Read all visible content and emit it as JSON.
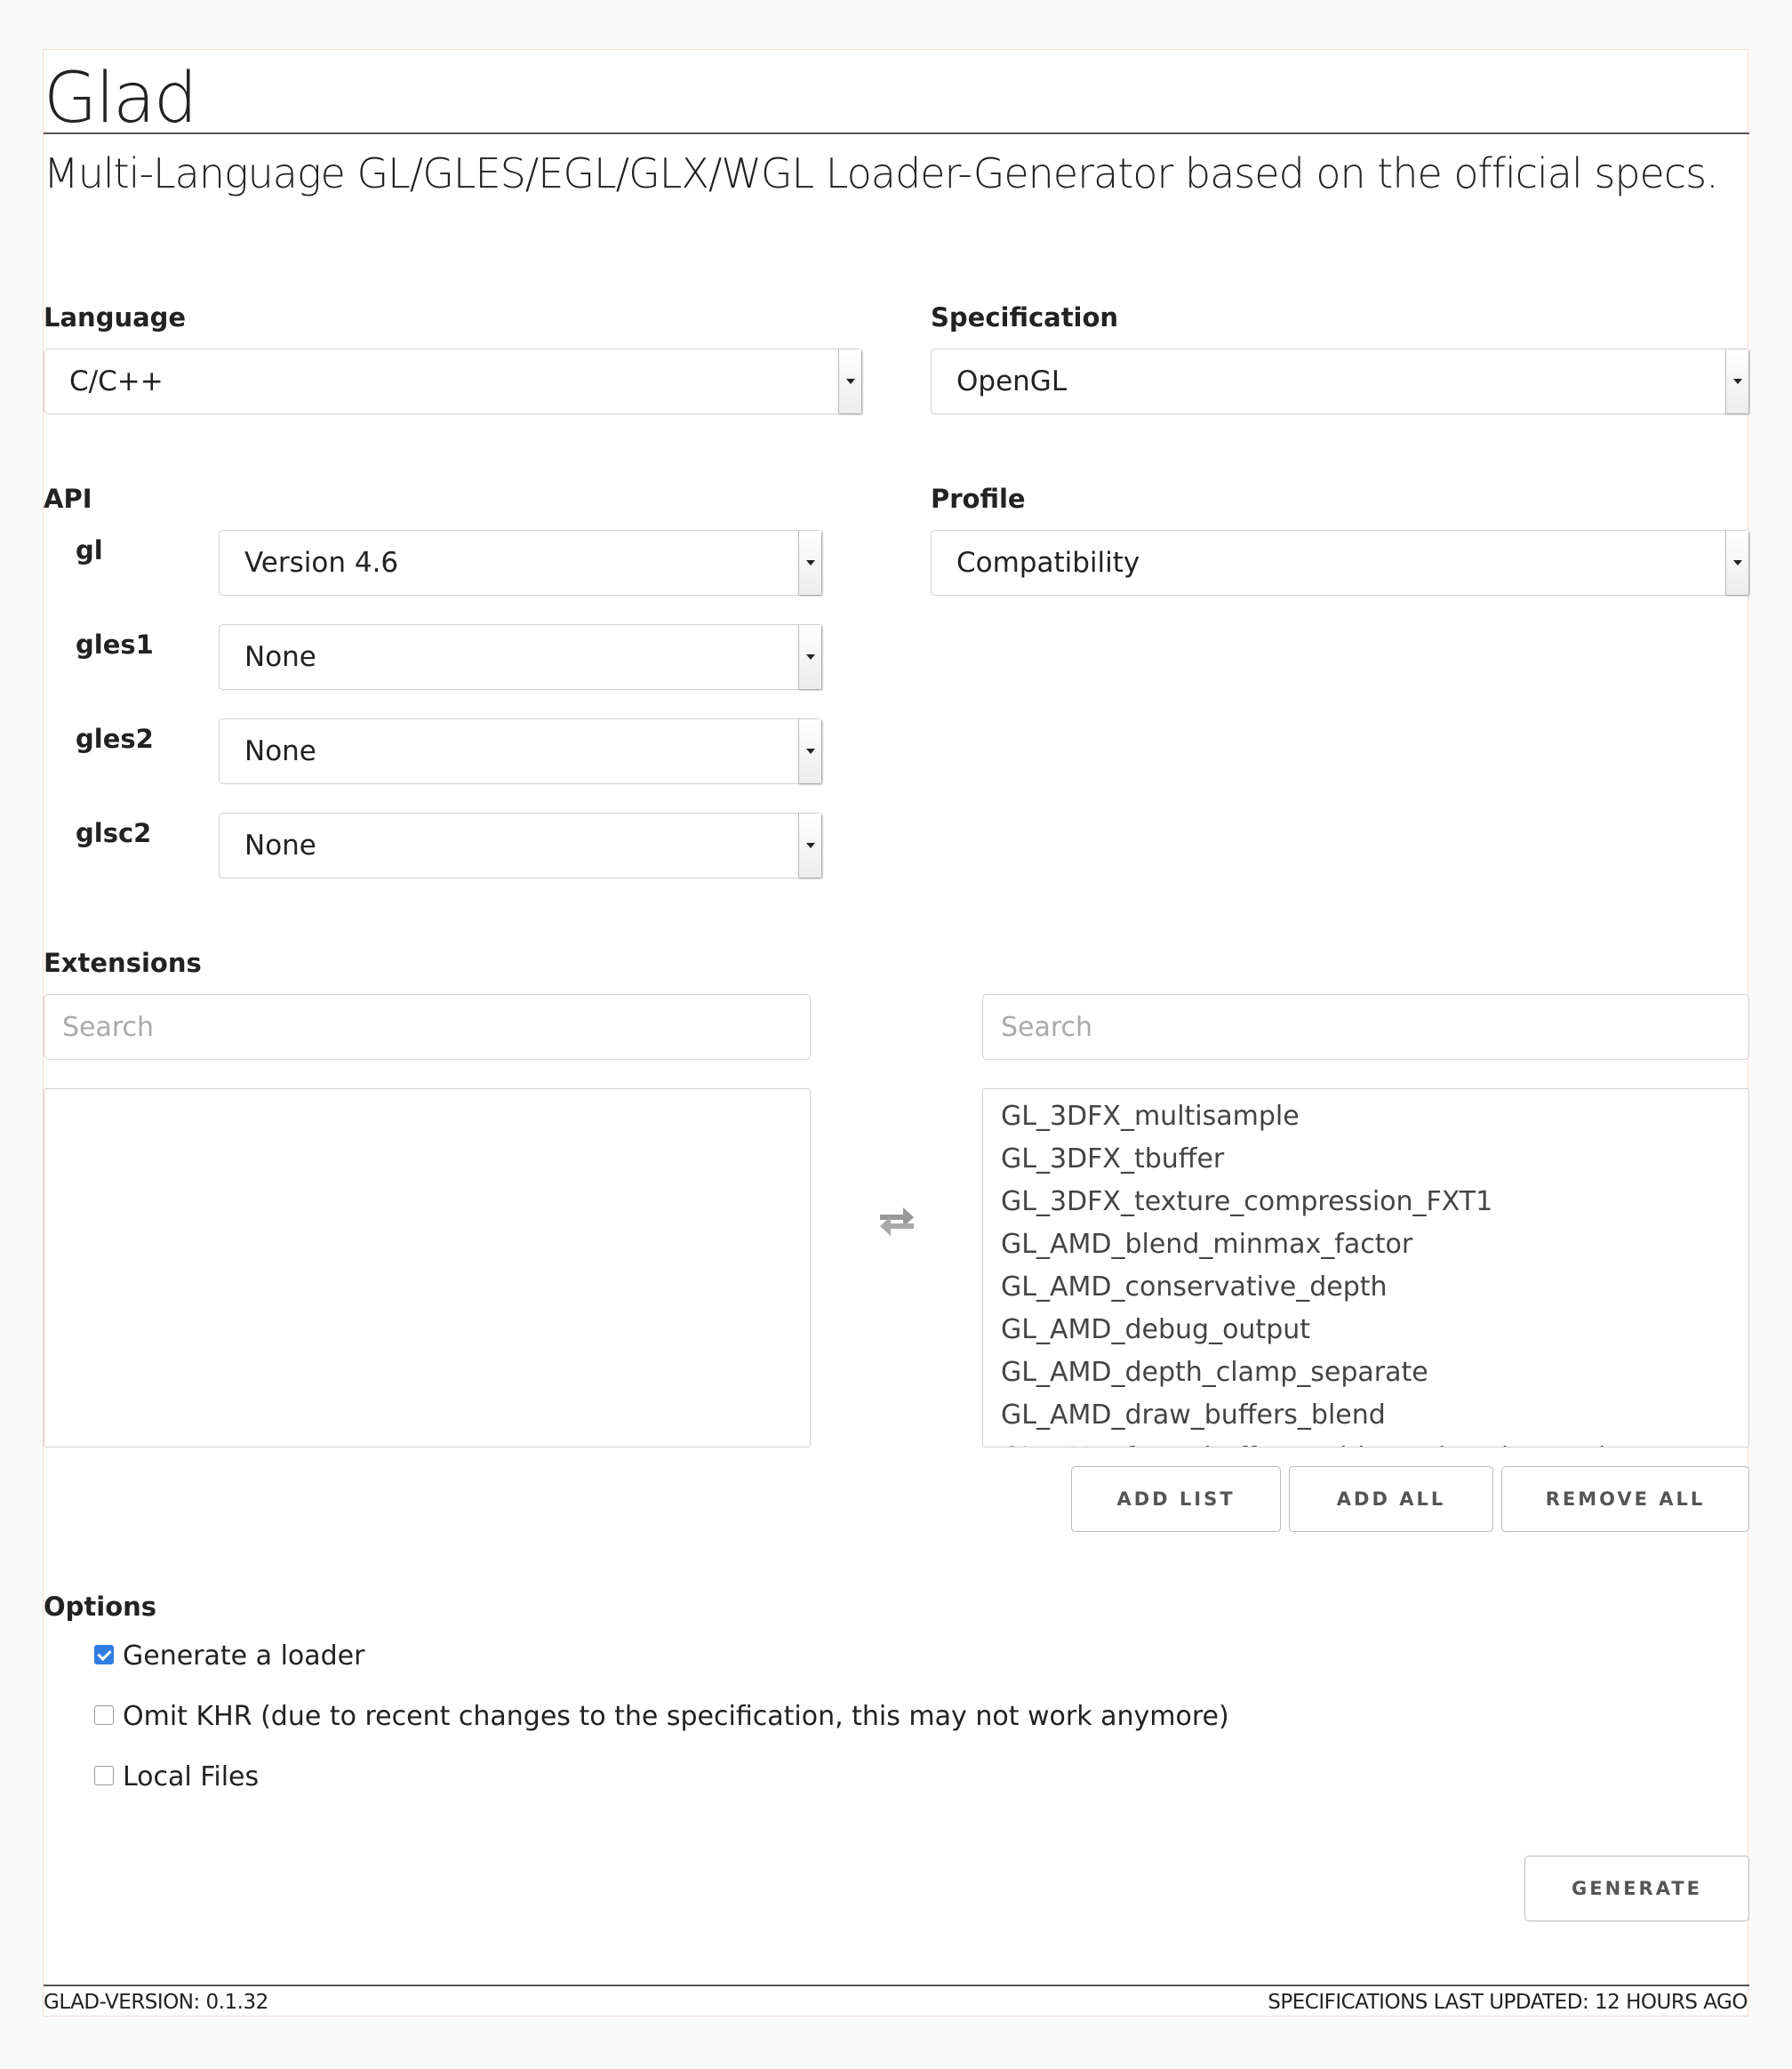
{
  "header": {
    "title": "Glad",
    "tagline": "Multi-Language GL/GLES/EGL/GLX/WGL Loader-Generator based on the official specs."
  },
  "language": {
    "label": "Language",
    "value": "C/C++"
  },
  "specification": {
    "label": "Specification",
    "value": "OpenGL"
  },
  "api": {
    "label": "API",
    "rows": [
      {
        "name": "gl",
        "value": "Version 4.6"
      },
      {
        "name": "gles1",
        "value": "None"
      },
      {
        "name": "gles2",
        "value": "None"
      },
      {
        "name": "glsc2",
        "value": "None"
      }
    ]
  },
  "profile": {
    "label": "Profile",
    "value": "Compatibility"
  },
  "extensions": {
    "label": "Extensions",
    "left_search_placeholder": "Search",
    "right_search_placeholder": "Search",
    "swap_icon": "exchange-arrows-icon",
    "available": [
      "GL_3DFX_multisample",
      "GL_3DFX_tbuffer",
      "GL_3DFX_texture_compression_FXT1",
      "GL_AMD_blend_minmax_factor",
      "GL_AMD_conservative_depth",
      "GL_AMD_debug_output",
      "GL_AMD_depth_clamp_separate",
      "GL_AMD_draw_buffers_blend",
      "GL_AMD_framebuffer_multisample_advanced"
    ],
    "buttons": {
      "add_list": "ADD LIST",
      "add_all": "ADD ALL",
      "remove_all": "REMOVE ALL"
    }
  },
  "options": {
    "label": "Options",
    "items": [
      {
        "label": "Generate a loader",
        "checked": true
      },
      {
        "label": "Omit KHR (due to recent changes to the specification, this may not work anymore)",
        "checked": false
      },
      {
        "label": "Local Files",
        "checked": false
      }
    ]
  },
  "generate_label": "GENERATE",
  "footer": {
    "version": "GLAD-VERSION: 0.1.32",
    "updated": "SPECIFICATIONS LAST UPDATED: 12 HOURS AGO"
  },
  "colors": {
    "accent": "#2f7de1",
    "border": "#d1d1d1",
    "rule": "#555555"
  }
}
